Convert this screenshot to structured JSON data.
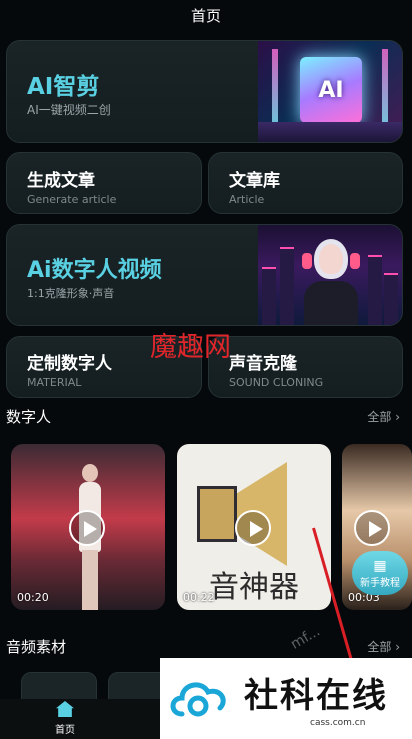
{
  "header": {
    "title": "首页"
  },
  "cards": {
    "ai_clip": {
      "title": "AI智剪",
      "subtitle": "AI一键视频二创",
      "thumb_text": "AI"
    },
    "article_gen": {
      "title": "生成文章",
      "subtitle": "Generate article"
    },
    "article_lib": {
      "title": "文章库",
      "subtitle": "Article"
    },
    "digital_video": {
      "title": "Ai数字人视频",
      "subtitle": "1:1克隆形象·声音"
    },
    "custom_human": {
      "title": "定制数字人",
      "subtitle": "MATERIAL"
    },
    "voice_clone": {
      "title": "声音克隆",
      "subtitle": "SOUND CLONING"
    }
  },
  "watermark_mid": "魔趣网",
  "sections": {
    "digital": {
      "label": "数字人",
      "more": "全部 ›"
    },
    "audio": {
      "label": "音频素材",
      "more": "全部 ›"
    }
  },
  "videos": [
    {
      "duration": "00:20"
    },
    {
      "duration": "00:22",
      "caption": "音神器"
    },
    {
      "duration": "00:03"
    }
  ],
  "tutorial": {
    "label": "新手教程",
    "icon": "map-icon"
  },
  "tabbar": {
    "home_label": "首页"
  },
  "brand": {
    "name": "社科在线",
    "url": "cass.com.cn"
  },
  "diag_mark": "mf...",
  "colors": {
    "accent": "#5ad1e3",
    "background": "#06090b",
    "card": "#1a2426",
    "watermark_red": "#e0262b"
  }
}
